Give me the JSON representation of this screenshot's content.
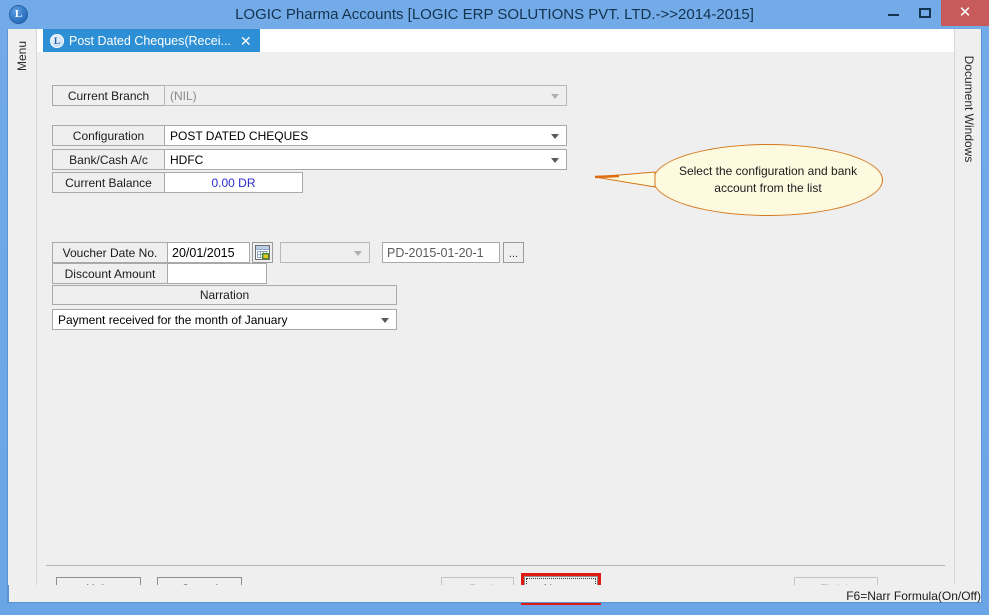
{
  "window": {
    "title": "LOGIC Pharma Accounts  [LOGIC ERP SOLUTIONS PVT. LTD.->>2014-2015]",
    "logo_letter": "L",
    "controls": {
      "minimize": "minimize-icon",
      "maximize": "maximize-icon",
      "close": "✕"
    }
  },
  "left_panel": {
    "label": "Menu"
  },
  "right_panel": {
    "label": "Document Windows"
  },
  "tabs": [
    {
      "label": "Post Dated Cheques(Recei...",
      "icon": "app-logo-icon",
      "close": "✕",
      "active": true
    }
  ],
  "form": {
    "current_branch": {
      "label": "Current Branch",
      "value": "(NIL)",
      "disabled": true
    },
    "configuration": {
      "label": "Configuration",
      "value": "POST DATED CHEQUES"
    },
    "bank_cash_ac": {
      "label": "Bank/Cash A/c",
      "value": "HDFC"
    },
    "current_balance": {
      "label": "Current Balance",
      "value": "0.00 DR",
      "color": "#2a2ad0"
    },
    "voucher": {
      "label": "Voucher Date  No.",
      "date_value": "20/01/2015",
      "calendar_icon": "calendar-icon",
      "series_value": "",
      "number_value": "PD-2015-01-20-1",
      "ellipsis_label": "..."
    },
    "discount_amount": {
      "label": "Discount Amount",
      "value": ""
    },
    "narration": {
      "header": "Narration",
      "value": "Payment received for the month of January"
    }
  },
  "callout": {
    "text": "Select the configuration and bank account from the list",
    "border_color": "#d4761a",
    "fill_color": "#fdfae0"
  },
  "footer": {
    "help": "Help",
    "cancel": "Cancel",
    "back": "< Back",
    "next": "Next >",
    "finish": "Finish",
    "next_highlight_color": "#e01b12"
  },
  "status": {
    "hint": "F6=Narr Formula(On/Off)"
  }
}
